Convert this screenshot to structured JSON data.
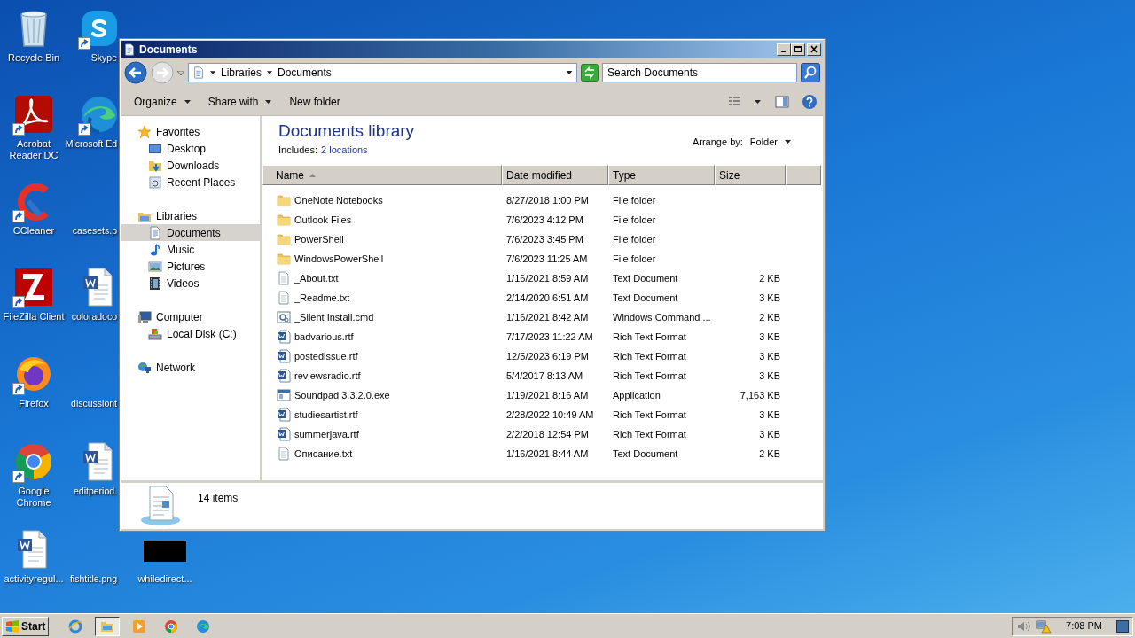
{
  "desktop_columns": [
    [
      {
        "label": "Recycle Bin",
        "kind": "recycle",
        "shortcut": false
      },
      {
        "label": "Acrobat Reader DC",
        "kind": "pdf",
        "shortcut": true
      },
      {
        "label": "CCleaner",
        "kind": "ccleaner",
        "shortcut": true
      },
      {
        "label": "FileZilla Client",
        "kind": "filezilla",
        "shortcut": true
      },
      {
        "label": "Firefox",
        "kind": "firefox",
        "shortcut": true
      },
      {
        "label": "Google Chrome",
        "kind": "chrome",
        "shortcut": true
      },
      {
        "label": "activityregul...",
        "kind": "word",
        "shortcut": false
      }
    ],
    [
      {
        "label": "Skype",
        "kind": "skype",
        "shortcut": true
      },
      {
        "label": "Microsoft Ed",
        "kind": "edge",
        "shortcut": true
      },
      {
        "label": "casesets.p",
        "kind": "none",
        "shortcut": false
      },
      {
        "label": "coloradoco",
        "kind": "word",
        "shortcut": false
      },
      {
        "label": "discussiont",
        "kind": "none",
        "shortcut": false
      },
      {
        "label": "editperiod.",
        "kind": "word",
        "shortcut": false
      },
      {
        "label": "fishtitle.png",
        "kind": "none",
        "shortcut": false
      }
    ],
    [
      {
        "label": "whiledirect...",
        "kind": "black",
        "shortcut": false
      }
    ]
  ],
  "window": {
    "title": "Documents",
    "breadcrumb": [
      "Libraries",
      "Documents"
    ],
    "search": {
      "placeholder": "Search Documents"
    },
    "toolbar": [
      {
        "label": "Organize",
        "dropdown": true
      },
      {
        "label": "Share with",
        "dropdown": true
      },
      {
        "label": "New folder",
        "dropdown": false
      }
    ],
    "sidebar": [
      {
        "label": "Favorites",
        "kind": "star",
        "selected": false,
        "children": [
          {
            "label": "Desktop",
            "kind": "desktop",
            "selected": false
          },
          {
            "label": "Downloads",
            "kind": "download",
            "selected": false
          },
          {
            "label": "Recent Places",
            "kind": "recent",
            "selected": false
          }
        ]
      },
      {
        "label": "Libraries",
        "kind": "library",
        "selected": false,
        "children": [
          {
            "label": "Documents",
            "kind": "document",
            "selected": true
          },
          {
            "label": "Music",
            "kind": "music",
            "selected": false
          },
          {
            "label": "Pictures",
            "kind": "pictures",
            "selected": false
          },
          {
            "label": "Videos",
            "kind": "videos",
            "selected": false
          }
        ]
      },
      {
        "label": "Computer",
        "kind": "computer",
        "selected": false,
        "children": [
          {
            "label": "Local Disk (C:)",
            "kind": "disk",
            "selected": false
          }
        ]
      },
      {
        "label": "Network",
        "kind": "network",
        "selected": false
      }
    ],
    "library": {
      "title": "Documents library",
      "includes": "Includes:",
      "locations": "2 locations",
      "arrange_label": "Arrange by:",
      "arrange_value": "Folder"
    },
    "table": {
      "columns": [
        {
          "label": "Name",
          "sorted": true
        },
        {
          "label": "Date modified",
          "sorted": false
        },
        {
          "label": "Type",
          "sorted": false
        },
        {
          "label": "Size",
          "sorted": false
        }
      ],
      "rows": [
        {
          "name": "OneNote Notebooks",
          "date": "8/27/2018 1:00 PM",
          "type": "File folder",
          "kind": "folder"
        },
        {
          "name": "Outlook Files",
          "date": "7/6/2023 4:12 PM",
          "type": "File folder",
          "kind": "folder"
        },
        {
          "name": "PowerShell",
          "date": "7/6/2023 3:45 PM",
          "type": "File folder",
          "kind": "folder"
        },
        {
          "name": "WindowsPowerShell",
          "date": "7/6/2023 11:25 AM",
          "type": "File folder",
          "kind": "folder"
        },
        {
          "name": "_About.txt",
          "date": "1/16/2021 8:59 AM",
          "type": "Text Document",
          "size": "2 KB",
          "kind": "text"
        },
        {
          "name": "_Readme.txt",
          "date": "2/14/2020 6:51 AM",
          "type": "Text Document",
          "size": "3 KB",
          "kind": "text"
        },
        {
          "name": "_Silent Install.cmd",
          "date": "1/16/2021 8:42 AM",
          "type": "Windows Command ...",
          "size": "2 KB",
          "kind": "cmd"
        },
        {
          "name": "badvarious.rtf",
          "date": "7/17/2023 11:22 AM",
          "type": "Rich Text Format",
          "size": "3 KB",
          "kind": "word"
        },
        {
          "name": "postedissue.rtf",
          "date": "12/5/2023 6:19 PM",
          "type": "Rich Text Format",
          "size": "3 KB",
          "kind": "word"
        },
        {
          "name": "reviewsradio.rtf",
          "date": "5/4/2017 8:13 AM",
          "type": "Rich Text Format",
          "size": "3 KB",
          "kind": "word"
        },
        {
          "name": "Soundpad 3.3.2.0.exe",
          "date": "1/19/2021 8:16 AM",
          "type": "Application",
          "size": "7,163 KB",
          "kind": "app"
        },
        {
          "name": "studiesartist.rtf",
          "date": "2/28/2022 10:49 AM",
          "type": "Rich Text Format",
          "size": "3 KB",
          "kind": "word"
        },
        {
          "name": "summerjava.rtf",
          "date": "2/2/2018 12:54 PM",
          "type": "Rich Text Format",
          "size": "3 KB",
          "kind": "word"
        },
        {
          "name": "Описание.txt",
          "date": "1/16/2021 8:44 AM",
          "type": "Text Document",
          "size": "2 KB",
          "kind": "text"
        }
      ]
    },
    "status_bar": {
      "count": "14 items"
    }
  },
  "taskbar": {
    "start": "Start",
    "apps": [
      {
        "kind": "ie",
        "selected": false
      },
      {
        "kind": "explorer",
        "selected": true
      },
      {
        "kind": "media",
        "selected": false
      },
      {
        "kind": "chrome",
        "selected": false
      },
      {
        "kind": "edge",
        "selected": false
      }
    ],
    "clock": "7:08 PM"
  }
}
